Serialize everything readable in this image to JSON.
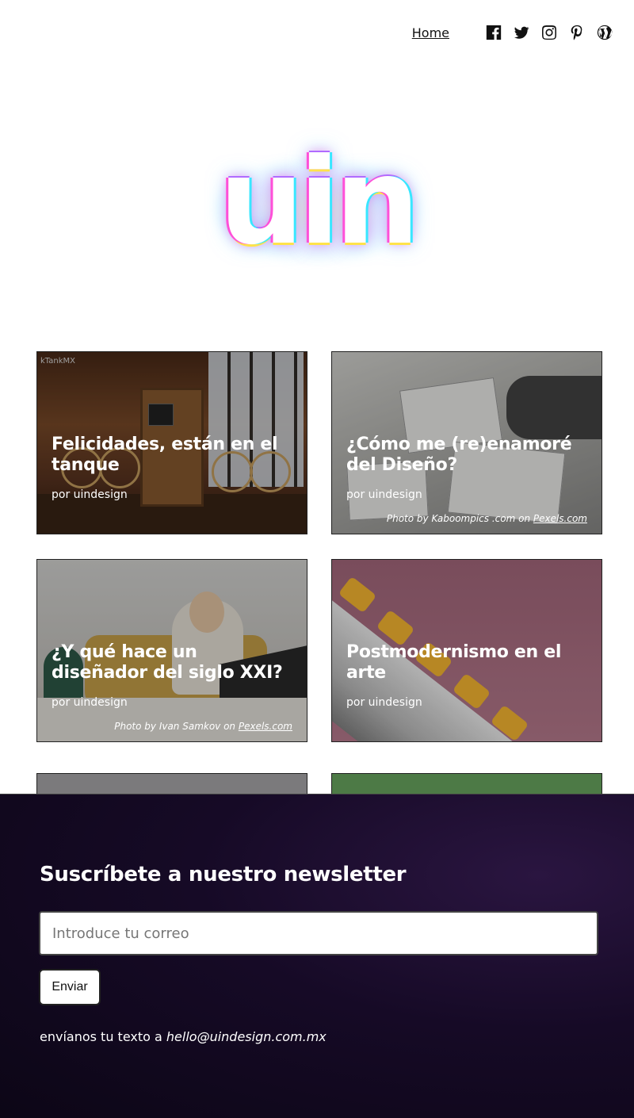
{
  "nav": {
    "home_label": "Home",
    "social": [
      "facebook-icon",
      "twitter-icon",
      "instagram-icon",
      "pinterest-icon",
      "wordpress-icon"
    ]
  },
  "logo": {
    "text": "uin"
  },
  "posts": [
    {
      "title": "Felicidades, están en el tanque",
      "author": "por uindesign",
      "credit": "",
      "credit_link": "",
      "image_caption": "kTankMX"
    },
    {
      "title": "¿Cómo me (re)enamoré del Diseño?",
      "author": "por uindesign",
      "credit": "Photo by Kaboompics .com on ",
      "credit_link": "Pexels.com"
    },
    {
      "title": "¿Y qué hace un diseñador del siglo XXI?",
      "author": "por uindesign",
      "credit": "Photo by Ivan Samkov on ",
      "credit_link": "Pexels.com"
    },
    {
      "title": "Postmodernismo en el arte",
      "author": "por uindesign",
      "credit": "",
      "credit_link": ""
    }
  ],
  "newsletter": {
    "heading": "Suscríbete a nuestro newsletter",
    "placeholder": "Introduce tu correo",
    "button_label": "Enviar",
    "contact_prefix": "envíanos tu texto a ",
    "contact_email": "hello@uindesign.com.mx"
  },
  "colors": {
    "footer_bg": "#160a26",
    "text_dark": "#111111"
  }
}
